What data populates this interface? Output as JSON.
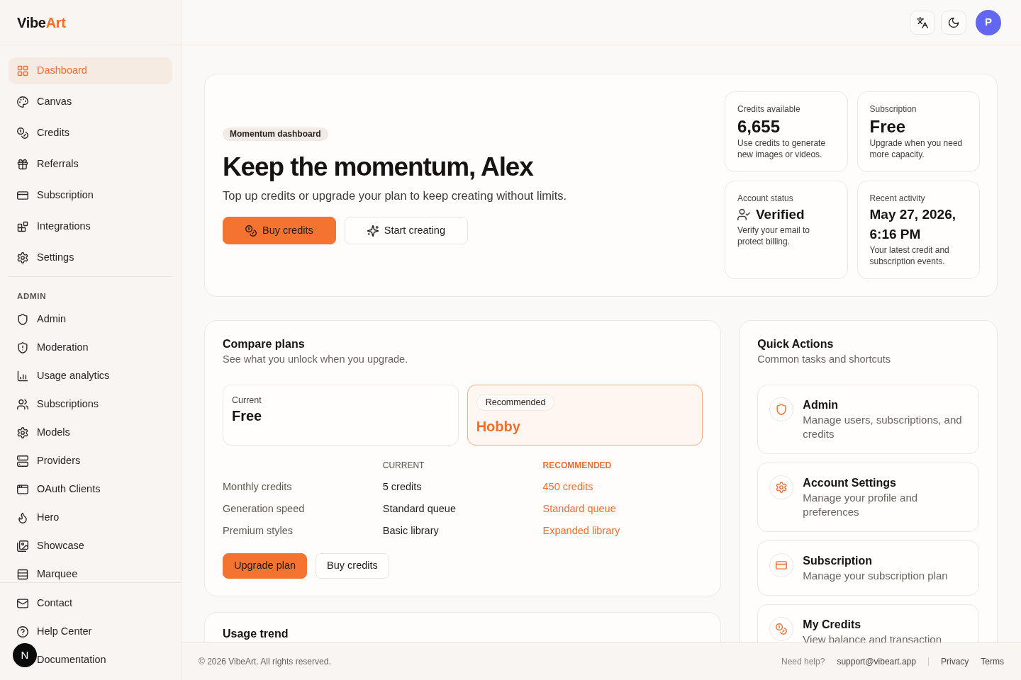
{
  "sidebar": {
    "logo": {
      "text": "Vibe",
      "accent": "Art"
    },
    "main_nav": [
      {
        "label": "Dashboard",
        "selected": true
      },
      {
        "label": "Canvas",
        "selected": false
      },
      {
        "label": "Credits",
        "selected": false
      },
      {
        "label": "Referrals",
        "selected": false
      },
      {
        "label": "Subscription",
        "selected": false
      },
      {
        "label": "Integrations",
        "selected": false
      },
      {
        "label": "Settings",
        "selected": false
      }
    ],
    "admin_heading": "ADMIN",
    "admin_nav": [
      {
        "label": "Admin",
        "selected": false
      },
      {
        "label": "Moderation",
        "selected": false
      },
      {
        "label": "Usage analytics",
        "selected": false
      },
      {
        "label": "Subscriptions",
        "selected": false
      },
      {
        "label": "Models",
        "selected": false
      },
      {
        "label": "Providers",
        "selected": false
      },
      {
        "label": "OAuth Clients",
        "selected": false
      },
      {
        "label": "Hero",
        "selected": false
      },
      {
        "label": "Showcase",
        "selected": false
      },
      {
        "label": "Marquee",
        "selected": false
      }
    ],
    "bottom_nav": [
      {
        "label": "Contact",
        "selected": false
      },
      {
        "label": "Help Center",
        "selected": false
      },
      {
        "label": "Documentation",
        "selected": false
      }
    ]
  },
  "floating_badge": {
    "label": "N"
  },
  "header": {
    "avatar": {
      "initial": "P"
    }
  },
  "hero": {
    "badge": "Momentum dashboard",
    "title": "Keep the momentum, Alex",
    "subtitle": "Top up credits or upgrade your plan to keep creating without limits.",
    "actions": [
      {
        "label": "Buy credits",
        "kind": "primary"
      },
      {
        "label": "Start creating",
        "kind": "secondary"
      }
    ],
    "stats": [
      {
        "label": "Credits available",
        "value": "6,655",
        "description": "Use credits to generate new images or videos.",
        "kind": "metric"
      },
      {
        "label": "Subscription",
        "value": "Free",
        "description": "Upgrade when you need more capacity.",
        "kind": "metric"
      },
      {
        "label": "Account status",
        "value": "Verified",
        "description": "Verify your email to protect billing.",
        "kind": "status"
      },
      {
        "label": "Recent activity",
        "value": "May 27, 2026, 6:16 PM",
        "description": "Your latest credit and subscription events.",
        "kind": "timestamp"
      }
    ]
  },
  "compare_plans": {
    "title": "Compare plans",
    "subtitle": "See what you unlock when you upgrade.",
    "plans": [
      {
        "tag": "Current",
        "name": "Free",
        "kind": "current"
      },
      {
        "tag": "Recommended",
        "name": "Hobby",
        "kind": "recommended"
      }
    ],
    "table": {
      "columns": [
        {
          "label": "CURRENT",
          "kind": "current"
        },
        {
          "label": "RECOMMENDED",
          "kind": "recommended"
        }
      ],
      "rows": [
        {
          "label": "Monthly credits",
          "values": [
            "5 credits",
            "450 credits"
          ]
        },
        {
          "label": "Generation speed",
          "values": [
            "Standard queue",
            "Standard queue"
          ]
        },
        {
          "label": "Premium styles",
          "values": [
            "Basic library",
            "Expanded library"
          ]
        }
      ]
    },
    "actions": [
      {
        "label": "Upgrade plan",
        "kind": "primary"
      },
      {
        "label": "Buy credits",
        "kind": "secondary"
      }
    ]
  },
  "usage_trend": {
    "title": "Usage trend"
  },
  "quick_actions": {
    "title": "Quick Actions",
    "subtitle": "Common tasks and shortcuts",
    "items": [
      {
        "title": "Admin",
        "description": "Manage users, subscriptions, and credits"
      },
      {
        "title": "Account Settings",
        "description": "Manage your profile and preferences"
      },
      {
        "title": "Subscription",
        "description": "Manage your subscription plan"
      },
      {
        "title": "My Credits",
        "description": "View balance and transaction"
      }
    ]
  },
  "footer": {
    "copyright": "© 2026 VibeArt. All rights reserved.",
    "help_label": "Need help?",
    "email": "support@vibeart.app",
    "links": [
      "Privacy",
      "Terms"
    ]
  }
}
